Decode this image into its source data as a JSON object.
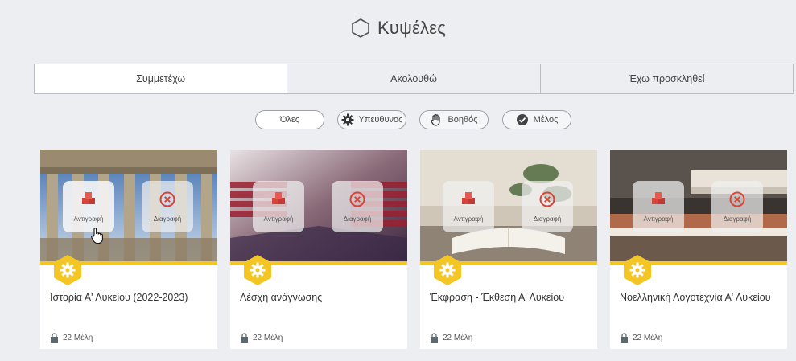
{
  "page": {
    "title": "Κυψέλες",
    "title_icon": "hexagon-outline-icon"
  },
  "tabs": [
    {
      "label": "Συμμετέχω",
      "active": true
    },
    {
      "label": "Ακολουθώ",
      "active": false
    },
    {
      "label": "Έχω προσκληθεί",
      "active": false
    }
  ],
  "filters": [
    {
      "label": "Όλες",
      "icon": "",
      "selected": true
    },
    {
      "label": "Υπεύθυνος",
      "icon": "gear-icon",
      "selected": false
    },
    {
      "label": "Βοηθός",
      "icon": "hand-icon",
      "selected": false
    },
    {
      "label": "Μέλος",
      "icon": "check-circle-icon",
      "selected": false
    }
  ],
  "actions": {
    "copy_label": "Αντιγραφή",
    "delete_label": "Διαγραφή"
  },
  "cards": [
    {
      "name": "Ιστορία Α' Λυκείου (2022-2023)",
      "members": "22 Μέλη",
      "image": "parthenon-photo"
    },
    {
      "name": "Λέσχη ανάγνωσης",
      "members": "22 Μέλη",
      "image": "library-photo"
    },
    {
      "name": "Έκφραση - Έκθεση Α' Λυκείου",
      "members": "22 Μέλη",
      "image": "open-book-photo"
    },
    {
      "name": "Νοελληνική Λογοτεχνία Α' Λυκείου",
      "members": "22 Μέλη",
      "image": "books-stack-photo"
    }
  ],
  "colors": {
    "accent": "#f3c623",
    "action_red": "#d9443a",
    "background": "#eceef1"
  }
}
